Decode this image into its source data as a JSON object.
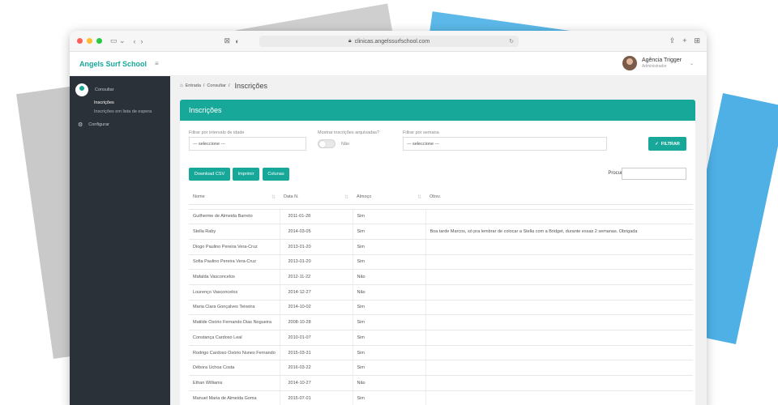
{
  "browser": {
    "url": "clinicas.angelssurfschool.com"
  },
  "app": {
    "brand": "Angels Surf School",
    "user_name": "Agência Trigger",
    "user_role": "Administrador"
  },
  "sidebar": {
    "consultar_label": "Consultar",
    "sub_items": [
      "Inscrições",
      "Inscrições em lista de espera"
    ],
    "configurar_label": "Configurar"
  },
  "breadcrumb": {
    "home": "Entrada",
    "section": "Consultar",
    "current": "Inscrições"
  },
  "card": {
    "title": "Inscrições"
  },
  "filters": {
    "age_label": "Filtrar por intervalo de idade",
    "age_value": "--- seleccione ---",
    "archived_label": "Mostrar inscrições arquivadas?",
    "archived_toggle_text": "Não",
    "week_label": "Filtrar por semana",
    "week_value": "--- seleccione ---",
    "filter_button": "FILTRAR"
  },
  "actions": {
    "download_csv": "Download CSV",
    "print": "Imprimir",
    "columns": "Colunas",
    "search_label": "Procurar:"
  },
  "table": {
    "headers": [
      "Nome",
      "Data N.",
      "Almoço",
      "Obsv."
    ],
    "rows": [
      [
        "Guilherme de Almeida Barreto",
        "2011-01-28",
        "Sim",
        ""
      ],
      [
        "Stella Raby",
        "2014-03-05",
        "Sim",
        "Boa tarde Marcos, só pra lembrar de colocar a Stella com a Bridget, durante essas 2 semanas. Obrigada"
      ],
      [
        "Diogo Paulino Pereira Vera-Cruz",
        "2013-01-20",
        "Sim",
        ""
      ],
      [
        "Sofia Paulino Pereira Vera-Cruz",
        "2013-01-20",
        "Sim",
        ""
      ],
      [
        "Mafalda Vasconcelos",
        "2012-11-22",
        "Não",
        ""
      ],
      [
        "Lourenço Vasconcelos",
        "2014-12-27",
        "Não",
        ""
      ],
      [
        "Maria Clara Gonçalves Teixeira",
        "2014-10-02",
        "Sim",
        ""
      ],
      [
        "Matilde Osório Fernando Dias Nogueira",
        "2008-10-28",
        "Sim",
        ""
      ],
      [
        "Constança Cardoso Leal",
        "2010-01-07",
        "Sim",
        ""
      ],
      [
        "Rodrigo Cardoso Osório Nunes Fernando",
        "2015-03-31",
        "Sim",
        ""
      ],
      [
        "Débora Uchoa Costa",
        "2016-03-22",
        "Sim",
        ""
      ],
      [
        "Ethan Williams",
        "2014-10-27",
        "Não",
        ""
      ],
      [
        "Manuel Maria de Almeida Goma",
        "2015-07-01",
        "Sim",
        ""
      ]
    ]
  },
  "colors": {
    "accent": "#17a89a",
    "sidebar_bg": "#2b3138"
  }
}
